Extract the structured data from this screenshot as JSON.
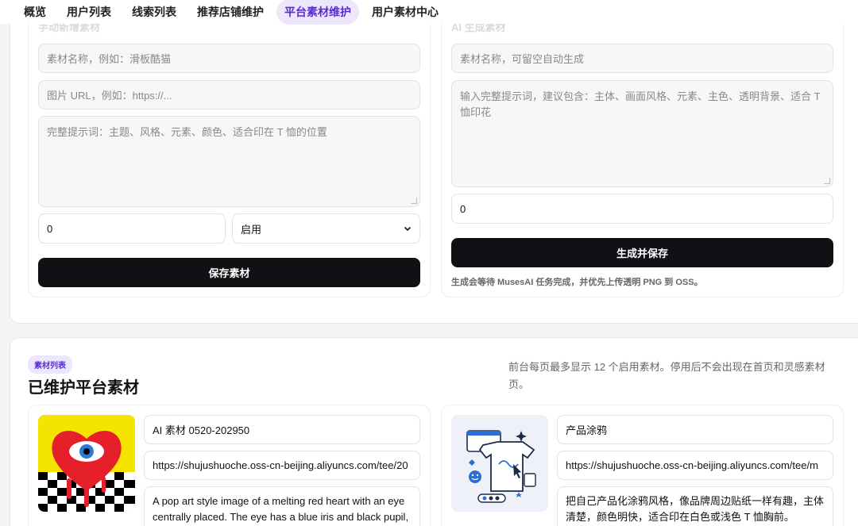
{
  "nav": {
    "items": [
      {
        "label": "概览",
        "active": false
      },
      {
        "label": "用户列表",
        "active": false
      },
      {
        "label": "线索列表",
        "active": false
      },
      {
        "label": "推荐店铺维护",
        "active": false
      },
      {
        "label": "平台素材维护",
        "active": true
      },
      {
        "label": "用户素材中心",
        "active": false
      }
    ]
  },
  "manual": {
    "heading": "手动新增素材",
    "name_placeholder": "素材名称，例如：滑板酷猫",
    "url_placeholder": "图片 URL，例如：https://...",
    "prompt_placeholder": "完整提示词：主题、风格、元素、颜色、适合印在 T 恤的位置",
    "sort_value": "0",
    "status_value": "启用",
    "save_label": "保存素材"
  },
  "ai": {
    "heading": "AI 生成素材",
    "name_placeholder": "素材名称，可留空自动生成",
    "prompt_placeholder": "输入完整提示词，建议包含：主体、画面风格、元素、主色、透明背景、适合 T 恤印花",
    "sort_value": "0",
    "generate_label": "生成并保存",
    "hint": "生成会等待 MusesAI 任务完成，并优先上传透明 PNG 到 OSS。"
  },
  "list": {
    "tag": "素材列表",
    "title": "已维护平台素材",
    "description": "前台每页最多显示 12 个启用素材。停用后不会出现在首页和灵感素材页。",
    "items": [
      {
        "name": "AI 素材 0520-202950",
        "url": "https://shujushuoche.oss-cn-beijing.aliyuncs.com/tee/20",
        "prompt": "A pop art style image of a melting red heart with an eye centrally placed. The eye has a blue iris and black pupil,"
      },
      {
        "name": "产品涂鸦",
        "url": "https://shujushuoche.oss-cn-beijing.aliyuncs.com/tee/m",
        "prompt": "把自己产品化涂鸦风格，像品牌周边贴纸一样有趣，主体清楚，颜色明快，适合印在白色或浅色 T 恤胸前。"
      }
    ]
  },
  "colors": {
    "accent": "#5b2bd6",
    "accent_bg": "#ede7fb",
    "button": "#0f1115"
  }
}
